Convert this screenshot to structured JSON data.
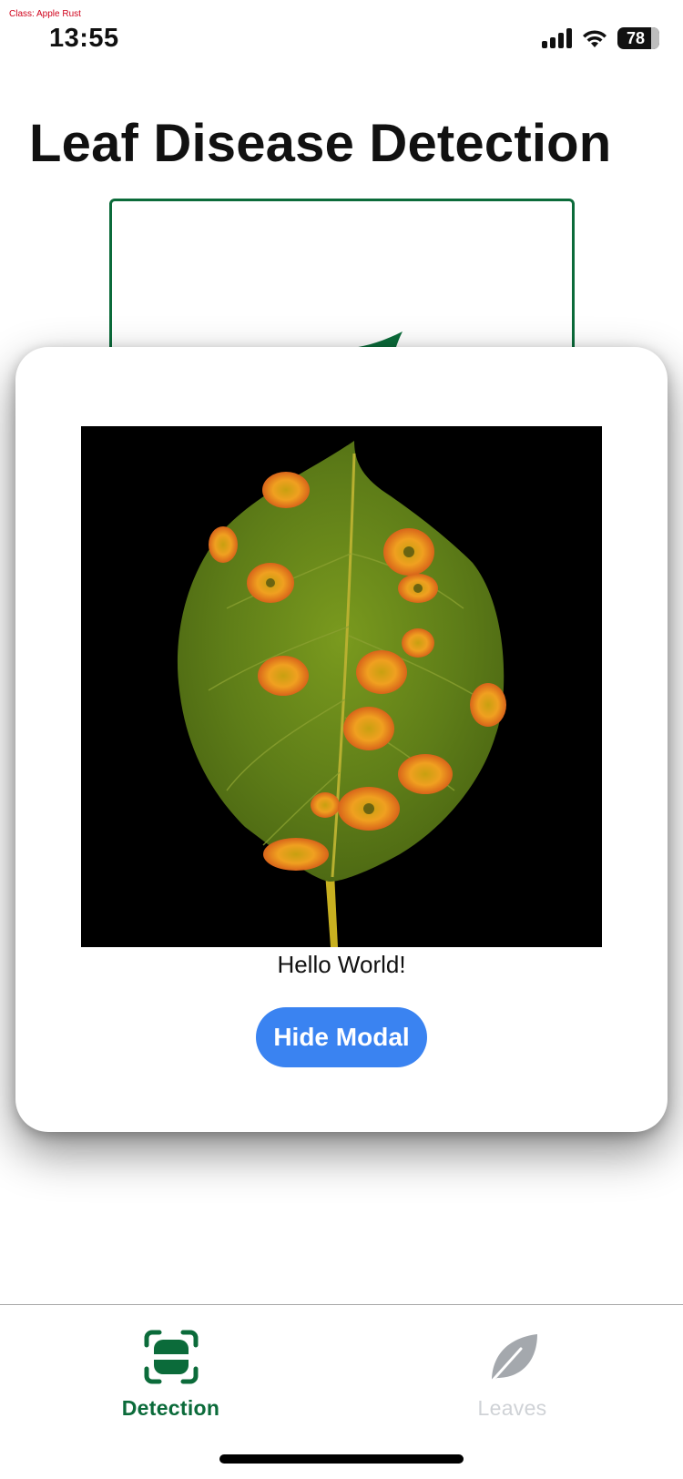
{
  "debug": {
    "class_label": "Class: Apple Rust"
  },
  "status_bar": {
    "time": "13:55",
    "battery": "78"
  },
  "page": {
    "title": "Leaf Disease Detection"
  },
  "modal": {
    "message": "Hello World!",
    "hide_button_label": "Hide Modal"
  },
  "tabs": [
    {
      "label": "Detection",
      "icon": "scan-icon",
      "active": true
    },
    {
      "label": "Leaves",
      "icon": "leaf-icon",
      "active": false
    }
  ],
  "colors": {
    "primary_green": "#0b6b3a",
    "button_blue": "#3a83f1",
    "tab_inactive": "#cfd2d6"
  }
}
